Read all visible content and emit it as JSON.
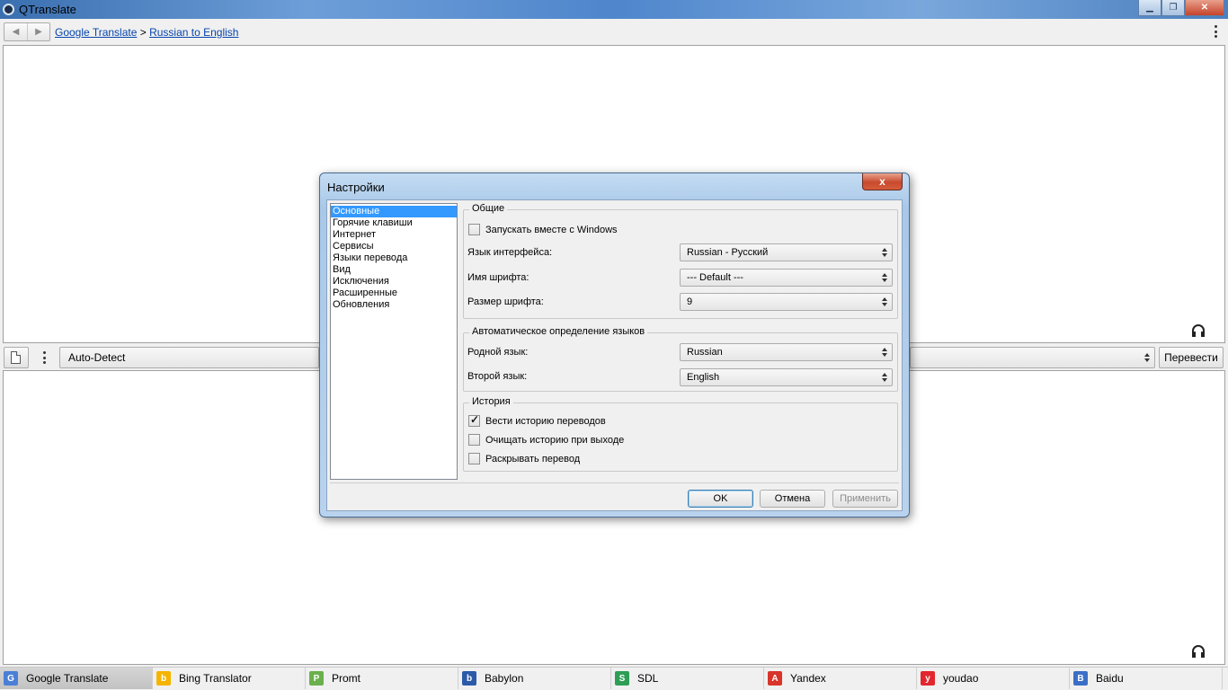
{
  "window": {
    "title": "QTranslate"
  },
  "nav": {
    "crumb_service": "Google Translate",
    "crumb_sep": ">",
    "crumb_direction": "Russian to English"
  },
  "toolbar": {
    "source_lang": "Auto-Detect",
    "translate_label": "Перевести"
  },
  "services": [
    {
      "label": "Google Translate",
      "icon": "google-icon",
      "color": "#4a7fd8",
      "glyph": "G"
    },
    {
      "label": "Bing Translator",
      "icon": "bing-icon",
      "color": "#f5b400",
      "glyph": "b"
    },
    {
      "label": "Promt",
      "icon": "promt-icon",
      "color": "#6ab04c",
      "glyph": "P"
    },
    {
      "label": "Babylon",
      "icon": "babylon-icon",
      "color": "#2b5aa8",
      "glyph": "b"
    },
    {
      "label": "SDL",
      "icon": "sdl-icon",
      "color": "#2e9e55",
      "glyph": "S"
    },
    {
      "label": "Yandex",
      "icon": "yandex-icon",
      "color": "#d8342a",
      "glyph": "A"
    },
    {
      "label": "youdao",
      "icon": "youdao-icon",
      "color": "#e3262e",
      "glyph": "y"
    },
    {
      "label": "Baidu",
      "icon": "baidu-icon",
      "color": "#3b6fc7",
      "glyph": "B"
    }
  ],
  "dialog": {
    "title": "Настройки",
    "close_label": "x",
    "nav_items": [
      "Основные",
      "Горячие клавиши",
      "Интернет",
      "Сервисы",
      "Языки перевода",
      "Вид",
      "Исключения",
      "Расширенные",
      "Обновления"
    ],
    "selected_nav": 0,
    "general": {
      "legend": "Общие",
      "autostart_label": "Запускать вместе с Windows",
      "autostart_checked": false,
      "ui_lang_label": "Язык интерфейса:",
      "ui_lang_value": "Russian - Русский",
      "font_name_label": "Имя шрифта:",
      "font_name_value": "--- Default ---",
      "font_size_label": "Размер шрифта:",
      "font_size_value": "9"
    },
    "autodetect": {
      "legend": "Автоматическое определение языков",
      "native_label": "Родной язык:",
      "native_value": "Russian",
      "second_label": "Второй язык:",
      "second_value": "English"
    },
    "history": {
      "legend": "История",
      "keep_label": "Вести историю переводов",
      "keep_checked": true,
      "clear_label": "Очищать историю при выходе",
      "clear_checked": false,
      "expand_label": "Раскрывать перевод",
      "expand_checked": false
    },
    "buttons": {
      "ok": "OK",
      "cancel": "Отмена",
      "apply": "Применить"
    }
  },
  "colors": {
    "selection": "#3399ff",
    "link": "#0645ad",
    "titlebar": "#4f86cc"
  }
}
